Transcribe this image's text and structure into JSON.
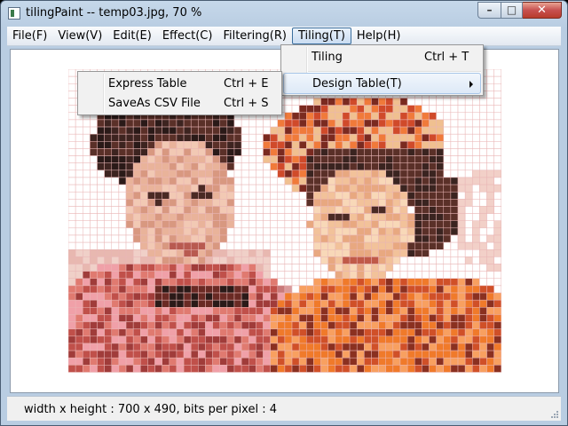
{
  "window": {
    "title": "tilingPaint -- temp03.jpg, 70 %"
  },
  "caption_buttons": {
    "minimize": "–",
    "maximize": "□",
    "close": "✕"
  },
  "menubar": [
    {
      "id": "file",
      "label": "File(F)"
    },
    {
      "id": "view",
      "label": "View(V)"
    },
    {
      "id": "edit",
      "label": "Edit(E)"
    },
    {
      "id": "effect",
      "label": "Effect(C)"
    },
    {
      "id": "filtering",
      "label": "Filtering(R)"
    },
    {
      "id": "tiling",
      "label": "Tiling(T)",
      "active": true
    },
    {
      "id": "help",
      "label": "Help(H)"
    }
  ],
  "tiling_menu": {
    "items": [
      {
        "label": "Tiling",
        "shortcut": "Ctrl + T"
      },
      {
        "label": "Design Table(T)",
        "submenu": true,
        "highlighted": true
      }
    ]
  },
  "design_table_submenu": {
    "items": [
      {
        "label": "Express Table",
        "shortcut": "Ctrl + E"
      },
      {
        "label": "SaveAs CSV File",
        "shortcut": "Ctrl + S"
      }
    ]
  },
  "image": {
    "subject": "mosaic-tiled photo of two people",
    "grid_color": "#e9b5b5"
  },
  "status": {
    "text": "width x height : 700 x 490, bits per pixel : 4"
  },
  "icons": [
    "app-icon",
    "minimize-icon",
    "maximize-icon",
    "close-icon",
    "submenu-arrow-icon",
    "resize-grip-icon"
  ]
}
